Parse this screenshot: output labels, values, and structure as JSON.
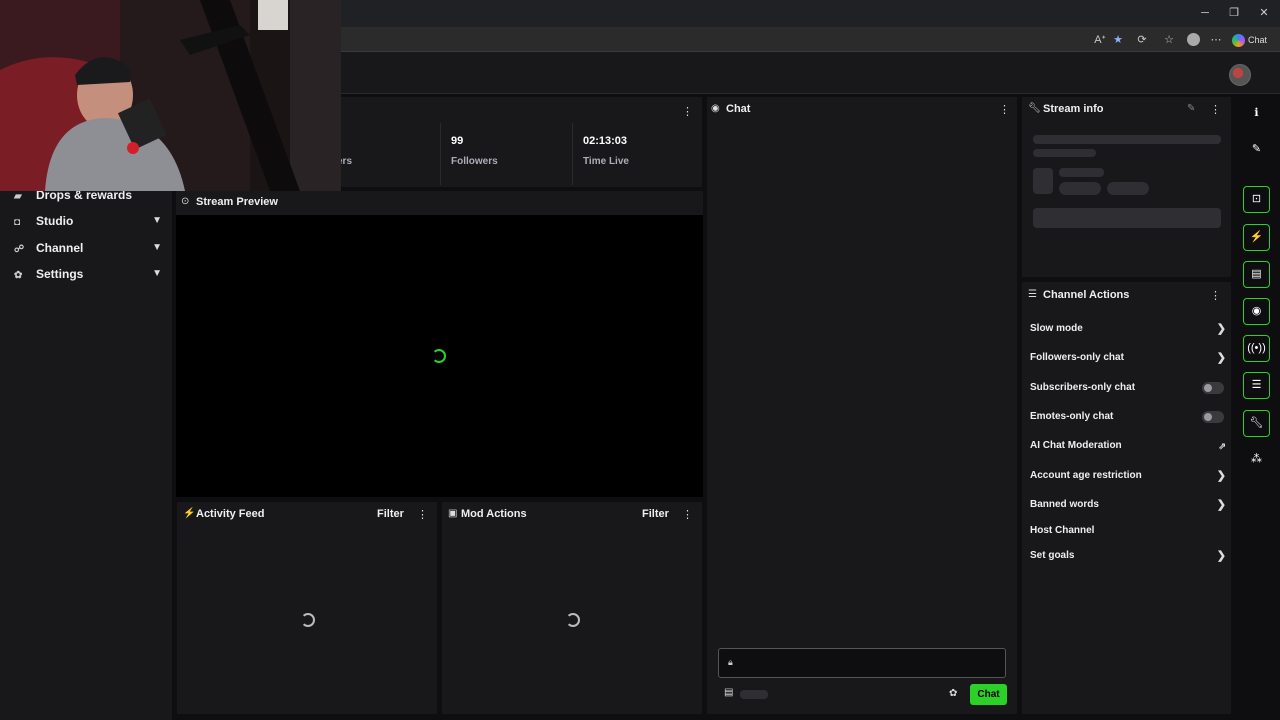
{
  "browser": {
    "window_controls": [
      "─",
      "❐",
      "✕"
    ],
    "copilot_label": "Chat"
  },
  "sidebar": {
    "items": [
      {
        "label": "Drops & rewards",
        "icon": "gift-icon"
      },
      {
        "label": "Studio",
        "icon": "studio-icon"
      },
      {
        "label": "Channel",
        "icon": "channel-icon"
      },
      {
        "label": "Settings",
        "icon": "gear-icon"
      }
    ]
  },
  "stats": [
    {
      "value": "",
      "label": "ers"
    },
    {
      "value": "99",
      "label": "Followers"
    },
    {
      "value": "02:13:03",
      "label": "Time Live"
    }
  ],
  "panels": {
    "stream_preview": "Stream Preview",
    "activity_feed": "Activity Feed",
    "mod_actions": "Mod Actions",
    "filter_label": "Filter",
    "chat": "Chat",
    "stream_info": "Stream info",
    "channel_actions": "Channel Actions"
  },
  "chat": {
    "send_label": "Chat",
    "input_placeholder": ""
  },
  "channel_actions": [
    {
      "label": "Slow mode",
      "control": "chevron"
    },
    {
      "label": "Followers-only chat",
      "control": "chevron"
    },
    {
      "label": "Subscribers-only chat",
      "control": "toggle",
      "on": false
    },
    {
      "label": "Emotes-only chat",
      "control": "toggle",
      "on": false
    },
    {
      "label": "AI Chat Moderation",
      "control": "external"
    },
    {
      "label": "Account age restriction",
      "control": "chevron"
    },
    {
      "label": "Banned words",
      "control": "chevron"
    },
    {
      "label": "Host Channel",
      "control": "none"
    },
    {
      "label": "Set goals",
      "control": "chevron"
    }
  ],
  "colors": {
    "accent": "#2bd126",
    "panel_bg": "#18181b",
    "page_bg": "#0e0e10"
  }
}
